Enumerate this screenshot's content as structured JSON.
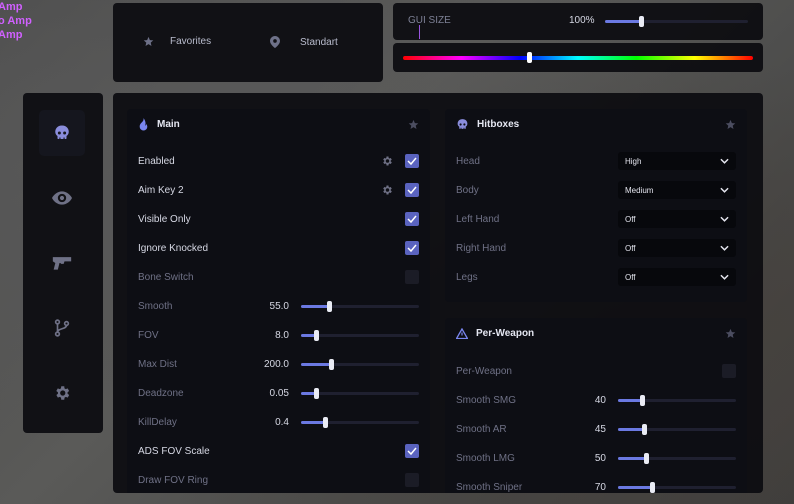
{
  "overlay_list": [
    "Amp",
    "o Amp",
    "Amp"
  ],
  "top_bar": {
    "favorites_label": "Favorites",
    "config_label": "Standart",
    "gui_size_label": "GUI SIZE",
    "gui_size_value": "100%",
    "gui_size_fraction": 0.25,
    "hue_fraction": 0.36
  },
  "sidebar": [
    {
      "icon": "skull-icon",
      "active": true
    },
    {
      "icon": "eye-icon",
      "active": false
    },
    {
      "icon": "pistol-icon",
      "active": false
    },
    {
      "icon": "branch-icon",
      "active": false
    },
    {
      "icon": "gear-icon",
      "active": false
    }
  ],
  "main": {
    "title": "Main",
    "enabled_label": "Enabled",
    "aimkey_label": "Aim Key 2",
    "visible_only_label": "Visible Only",
    "ignore_knocked_label": "Ignore Knocked",
    "bone_switch_label": "Bone Switch",
    "smooth": {
      "label": "Smooth",
      "value": "55.0",
      "fraction": 0.24
    },
    "fov": {
      "label": "FOV",
      "value": "8.0",
      "fraction": 0.13
    },
    "max_dist": {
      "label": "Max Dist",
      "value": "200.0",
      "fraction": 0.25
    },
    "deadzone": {
      "label": "Deadzone",
      "value": "0.05",
      "fraction": 0.13
    },
    "kill_delay": {
      "label": "KillDelay",
      "value": "0.4",
      "fraction": 0.2
    },
    "ads_fov_label": "ADS FOV Scale",
    "draw_fov_label": "Draw FOV Ring"
  },
  "hitboxes": {
    "title": "Hitboxes",
    "rows": [
      {
        "label": "Head",
        "value": "High"
      },
      {
        "label": "Body",
        "value": "Medium"
      },
      {
        "label": "Left Hand",
        "value": "Off"
      },
      {
        "label": "Right Hand",
        "value": "Off"
      },
      {
        "label": "Legs",
        "value": "Off"
      }
    ]
  },
  "per_weapon": {
    "title": "Per-Weapon",
    "toggle_label": "Per-Weapon",
    "smg": {
      "label": "Smooth SMG",
      "value": "40",
      "fraction": 0.2
    },
    "ar": {
      "label": "Smooth AR",
      "value": "45",
      "fraction": 0.22
    },
    "lmg": {
      "label": "Smooth LMG",
      "value": "50",
      "fraction": 0.24
    },
    "sniper": {
      "label": "Smooth Sniper",
      "value": "70",
      "fraction": 0.29
    }
  }
}
